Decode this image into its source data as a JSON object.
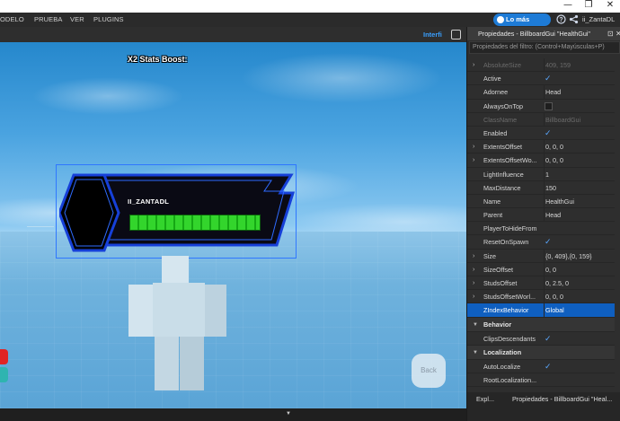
{
  "window": {
    "restore_glyph": "❐",
    "close_glyph": "✕"
  },
  "menubar": {
    "items": [
      "ODELO",
      "PRUEBA",
      "VER",
      "PLUGINS"
    ],
    "news_button": "Lo más nuevo",
    "username": "ii_ZantaDL",
    "icons": [
      "help-icon",
      "share-icon"
    ]
  },
  "viewport": {
    "toolbar_label": "Interfi",
    "stats_label": "X2 Stats Boost:",
    "player_name": "II_ZANTADL",
    "back_label": "Back",
    "health_fraction": 1.0
  },
  "properties": {
    "header": "Propiedades - BillboardGui \"HealthGui\"",
    "filter_placeholder": "Propiedades del filtro: (Control+Mayúsculas+P)",
    "rows": [
      {
        "name": "AbsoluteSize",
        "value": "409, 159",
        "arrow": "›",
        "dim": true,
        "type": "text"
      },
      {
        "name": "Active",
        "value": "",
        "type": "check",
        "checked": true
      },
      {
        "name": "Adornee",
        "value": "Head",
        "type": "text"
      },
      {
        "name": "AlwaysOnTop",
        "value": "",
        "type": "check",
        "checked": false
      },
      {
        "name": "ClassName",
        "value": "BillboardGui",
        "dim": true,
        "type": "text"
      },
      {
        "name": "Enabled",
        "value": "",
        "type": "check",
        "checked": true
      },
      {
        "name": "ExtentsOffset",
        "value": "0, 0, 0",
        "arrow": "›",
        "type": "text"
      },
      {
        "name": "ExtentsOffsetWo...",
        "value": "0, 0, 0",
        "arrow": "›",
        "type": "text"
      },
      {
        "name": "LightInfluence",
        "value": "1",
        "type": "text"
      },
      {
        "name": "MaxDistance",
        "value": "150",
        "type": "text"
      },
      {
        "name": "Name",
        "value": "HealthGui",
        "type": "text"
      },
      {
        "name": "Parent",
        "value": "Head",
        "type": "text"
      },
      {
        "name": "PlayerToHideFrom",
        "value": "",
        "type": "text"
      },
      {
        "name": "ResetOnSpawn",
        "value": "",
        "type": "check",
        "checked": true
      },
      {
        "name": "Size",
        "value": "{0, 409},{0, 159}",
        "arrow": "›",
        "type": "text"
      },
      {
        "name": "SizeOffset",
        "value": "0, 0",
        "arrow": "›",
        "type": "text"
      },
      {
        "name": "StudsOffset",
        "value": "0, 2.5, 0",
        "arrow": "›",
        "type": "text"
      },
      {
        "name": "StudsOffsetWorl...",
        "value": "0, 0, 0",
        "arrow": "›",
        "type": "text"
      },
      {
        "name": "ZIndexBehavior",
        "value": "Global",
        "type": "text",
        "selected": true
      }
    ],
    "sections": [
      {
        "title": "Behavior",
        "rows": [
          {
            "name": "ClipsDescendants",
            "value": "",
            "type": "check",
            "checked": true
          }
        ]
      },
      {
        "title": "Localization",
        "rows": [
          {
            "name": "AutoLocalize",
            "value": "",
            "type": "check",
            "checked": true
          },
          {
            "name": "RootLocalization...",
            "value": "",
            "type": "text"
          }
        ]
      }
    ],
    "tabs": [
      "Expl...",
      "Propiedades - BillboardGui \"Heal..."
    ]
  },
  "colors": {
    "accent": "#1e7bd6",
    "selection": "#0f5fc0",
    "health": "#33d52c",
    "checkmark": "#5aa8ff"
  }
}
